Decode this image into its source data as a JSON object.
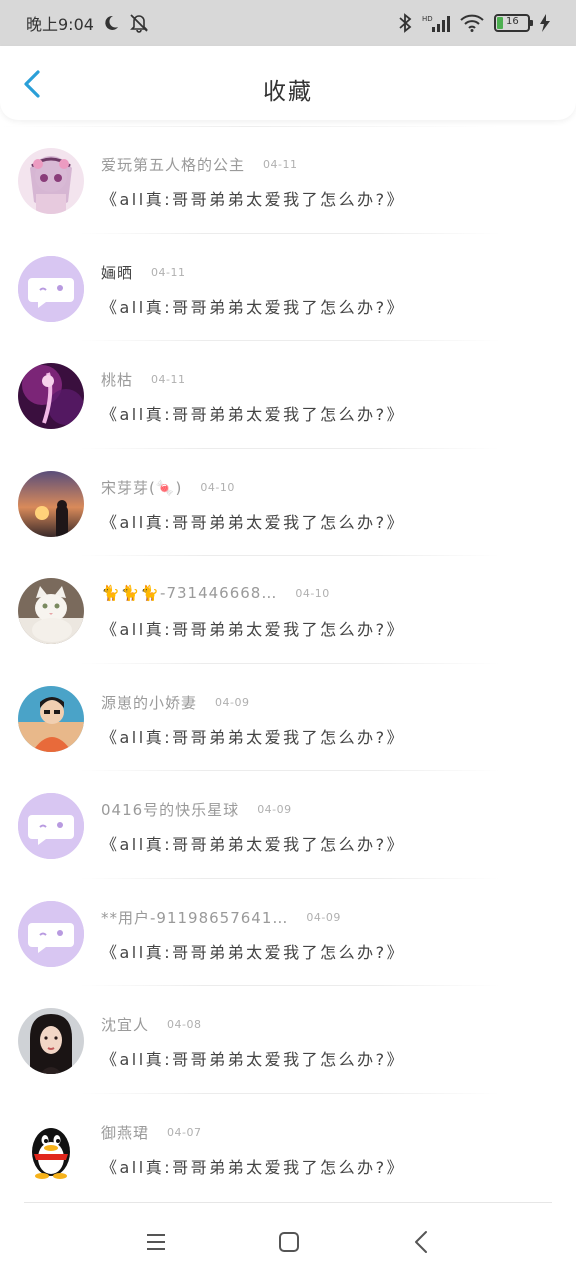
{
  "status_bar": {
    "time": "晚上9:04",
    "battery": "16"
  },
  "header": {
    "title": "收藏"
  },
  "list": [
    {
      "username": "爱玩第五人格的公主",
      "date": "04-11",
      "title": "《all真:哥哥弟弟太爱我了怎么办?》",
      "avatar": "anime-girl"
    },
    {
      "username": "婳晒",
      "date": "04-11",
      "title": "《all真:哥哥弟弟太爱我了怎么办?》",
      "avatar": "default"
    },
    {
      "username": "桃枯",
      "date": "04-11",
      "title": "《all真:哥哥弟弟太爱我了怎么办?》",
      "avatar": "purple-art"
    },
    {
      "username": "宋芽芽(🍬)",
      "date": "04-10",
      "title": "《all真:哥哥弟弟太爱我了怎么办?》",
      "avatar": "sunset"
    },
    {
      "username": "🐈🐈🐈-731446668…",
      "date": "04-10",
      "title": "《all真:哥哥弟弟太爱我了怎么办?》",
      "avatar": "cat"
    },
    {
      "username": "源崽的小娇妻",
      "date": "04-09",
      "title": "《all真:哥哥弟弟太爱我了怎么办?》",
      "avatar": "boy"
    },
    {
      "username": "0416号的快乐星球",
      "date": "04-09",
      "title": "《all真:哥哥弟弟太爱我了怎么办?》",
      "avatar": "default"
    },
    {
      "username": "**用户-91198657641…",
      "date": "04-09",
      "title": "《all真:哥哥弟弟太爱我了怎么办?》",
      "avatar": "default"
    },
    {
      "username": "沈宜人",
      "date": "04-08",
      "title": "《all真:哥哥弟弟太爱我了怎么办?》",
      "avatar": "girl-photo"
    },
    {
      "username": "御燕珺",
      "date": "04-07",
      "title": "《all真:哥哥弟弟太爱我了怎么办?》",
      "avatar": "qq-penguin"
    }
  ],
  "colors": {
    "accent": "#2a9fd8",
    "default_avatar_bg": "#d8c6f2"
  },
  "nav": {
    "icons": [
      "menu-icon",
      "home-icon",
      "back-icon"
    ]
  }
}
